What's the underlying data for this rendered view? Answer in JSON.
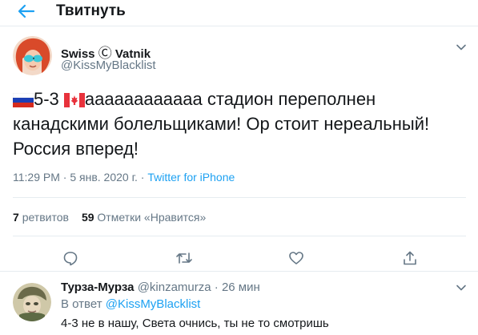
{
  "header": {
    "title": "Твитнуть",
    "back_icon": "arrow-left-icon"
  },
  "tweet": {
    "author": {
      "name": "Swiss",
      "name_symbol": "Ⓒ",
      "name_suffix": "Vatnik",
      "handle": "@KissMyBlacklist"
    },
    "text": {
      "score": "5-3",
      "body": "аааааааааааа стадион переполнен канадскими болельщиками! Ор стоит нереальный! Россия вперед!",
      "flags": [
        "russia-flag",
        "canada-flag"
      ]
    },
    "meta": {
      "time": "11:29 PM",
      "separator": "·",
      "date": "5 янв. 2020 г.",
      "source": "Twitter for iPhone"
    },
    "stats": {
      "retweets_count": "7",
      "retweets_label": "ретвитов",
      "likes_count": "59",
      "likes_label": "Отметки «Нравится»"
    },
    "actions": [
      "reply-icon",
      "retweet-icon",
      "like-icon",
      "share-icon"
    ]
  },
  "reply": {
    "name": "Турза-Мурза",
    "handle": "@kinzamurza",
    "dot": "·",
    "time": "26 мин",
    "replying_to_label": "В ответ",
    "replying_to_handle": "@KissMyBlacklist",
    "text": "4-3 не в нашу, Света очнись, ты не то смотришь"
  },
  "colors": {
    "accent": "#1da1f2",
    "text": "#14171a",
    "secondary": "#657786",
    "border": "#e6ecf0"
  }
}
